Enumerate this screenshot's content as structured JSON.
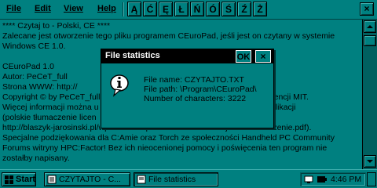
{
  "menu": {
    "items": [
      "File",
      "Edit",
      "View",
      "Help"
    ],
    "chars": [
      "Ą",
      "Ć",
      "Ę",
      "Ł",
      "Ń",
      "Ó",
      "Ś",
      "Ź",
      "Ż"
    ],
    "close": "×"
  },
  "document": {
    "lines": [
      "**** Czytaj to - Polski, CE ****",
      "Zalecane jest otworzenie tego pliku programem CEuroPad, jeśli jest on czytany w systemie",
      "Windows CE 1.0.",
      "",
      "CEuroPad 1.0",
      "Autor: PeCeT_full",
      "Strona WWW: http://",
      "Copyright © by PeCeT_full                                                        zasadach licencji MIT.",
      "Więcej informacji można u                                                    łączonym do aplikacji",
      "(polskie tłumaczenie licen",
      "http://blaszyk-jarosinski.pl/wp-content/uploads/2008/05/licencja-mit-tlumaczenie.pdf).",
      "Specjalne podziękowania dla C:Amie oraz Torch ze społeczności Handheld PC Community",
      "Forums witryny HPC:Factor! Bez ich nieocenionej pomocy i poświęcenia ten program nie",
      "zostałby napisany."
    ]
  },
  "dialog": {
    "title": "File statistics",
    "ok": "OK",
    "close": "×",
    "file_name": "File name: CZYTAJTO.TXT",
    "file_path": "File path: \\Program\\CEuroPad\\",
    "num_chars": "Number of characters: 3222"
  },
  "taskbar": {
    "start": "Start",
    "task1": "CZYTAJTO - C...",
    "task2": "File statistics",
    "time": "4:46 PM"
  }
}
